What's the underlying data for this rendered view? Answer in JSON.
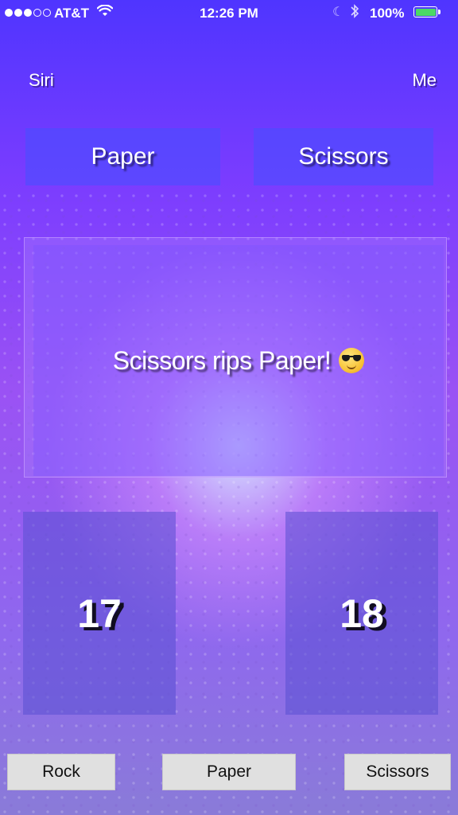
{
  "status_bar": {
    "carrier": "AT&T",
    "time": "12:26 PM",
    "battery_percent": "100%",
    "signal_bars_full": 3,
    "signal_bars_total": 5,
    "icons": [
      "wifi-icon",
      "moon-icon",
      "bluetooth-icon",
      "battery-icon"
    ]
  },
  "players": {
    "opponent_label": "Siri",
    "user_label": "Me"
  },
  "choices": {
    "siri_choice": "Paper",
    "my_choice": "Scissors"
  },
  "result": {
    "message": "Scissors rips Paper!",
    "emoji": "sunglasses-face-icon"
  },
  "scores": {
    "siri": "17",
    "me": "18"
  },
  "actions": {
    "rock": "Rock",
    "paper": "Paper",
    "scissors": "Scissors"
  },
  "colors": {
    "background_top": "#4f35ff",
    "background_bottom": "#8a7bd8",
    "choice_box": "#4650ff",
    "score_box": "#5a50d2",
    "button_bg": "#e0e0e0",
    "battery_fill": "#4cd964"
  }
}
